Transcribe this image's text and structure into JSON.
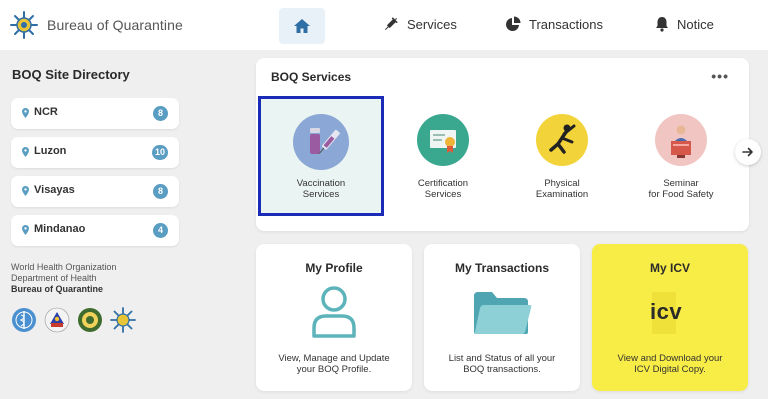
{
  "header": {
    "brand": "Bureau of Quarantine",
    "nav": [
      {
        "label": "Services",
        "icon": "syringe-icon"
      },
      {
        "label": "Transactions",
        "icon": "pie-chart-icon"
      },
      {
        "label": "Notice",
        "icon": "bell-icon"
      }
    ],
    "home_icon": "home-icon"
  },
  "sidebar": {
    "title": "BOQ Site Directory",
    "items": [
      {
        "label": "NCR",
        "count": "8"
      },
      {
        "label": "Luzon",
        "count": "10"
      },
      {
        "label": "Visayas",
        "count": "8"
      },
      {
        "label": "Mindanao",
        "count": "4"
      }
    ],
    "org": [
      "World Health Organization",
      "Department of Health",
      "Bureau of Quarantine"
    ]
  },
  "services": {
    "title": "BOQ Services",
    "more": "•••",
    "items": [
      {
        "line1": "Vaccination",
        "line2": "Services",
        "selected": true
      },
      {
        "line1": "Certification",
        "line2": "Services"
      },
      {
        "line1": "Physical",
        "line2": "Examination"
      },
      {
        "line1": "Seminar",
        "line2": "for Food Safety"
      }
    ]
  },
  "tiles": [
    {
      "title": "My Profile",
      "desc1": "View, Manage and Update",
      "desc2": "your BOQ Profile."
    },
    {
      "title": "My Transactions",
      "desc1": "List and Status of all your",
      "desc2": "BOQ transactions."
    },
    {
      "title": "My ICV",
      "desc1": "View and Download your",
      "desc2": "ICV Digital Copy.",
      "logo_text": "icv"
    }
  ],
  "colors": {
    "badge": "#5a9dc2",
    "selected_border": "#1a2bb8",
    "icv_tile": "#f8ec46"
  }
}
